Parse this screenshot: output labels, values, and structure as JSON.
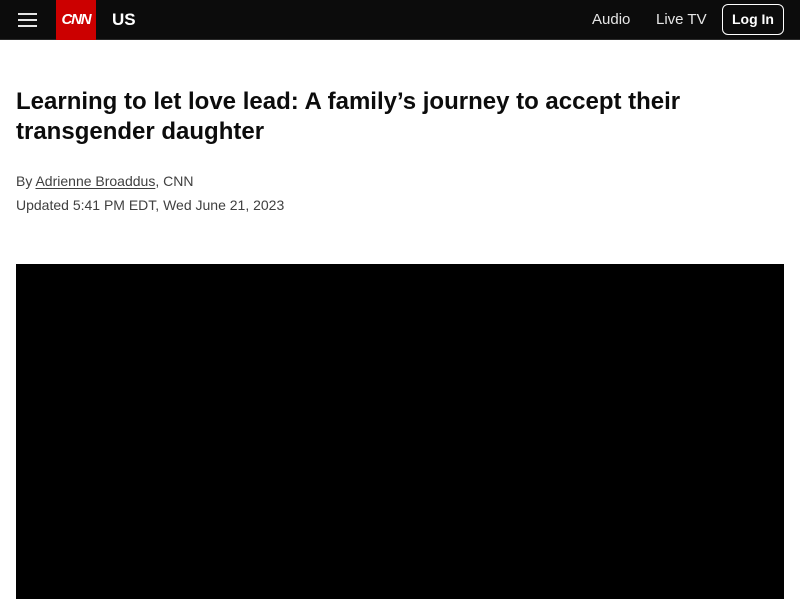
{
  "header": {
    "menu_icon": "hamburger-menu-icon",
    "logo_text": "CNN",
    "brand_color": "#cc0000",
    "section": "US",
    "nav": {
      "audio": "Audio",
      "live_tv": "Live TV"
    },
    "login_label": "Log In"
  },
  "article": {
    "headline": "Learning to let love lead: A family’s journey to accept their transgender daughter",
    "byline": {
      "prefix": "By ",
      "author": "Adrienne Broaddus",
      "suffix": ", CNN"
    },
    "timestamp": "Updated 5:41 PM EDT, Wed June 21, 2023"
  },
  "media": {
    "type": "video-player",
    "background": "#000000"
  }
}
